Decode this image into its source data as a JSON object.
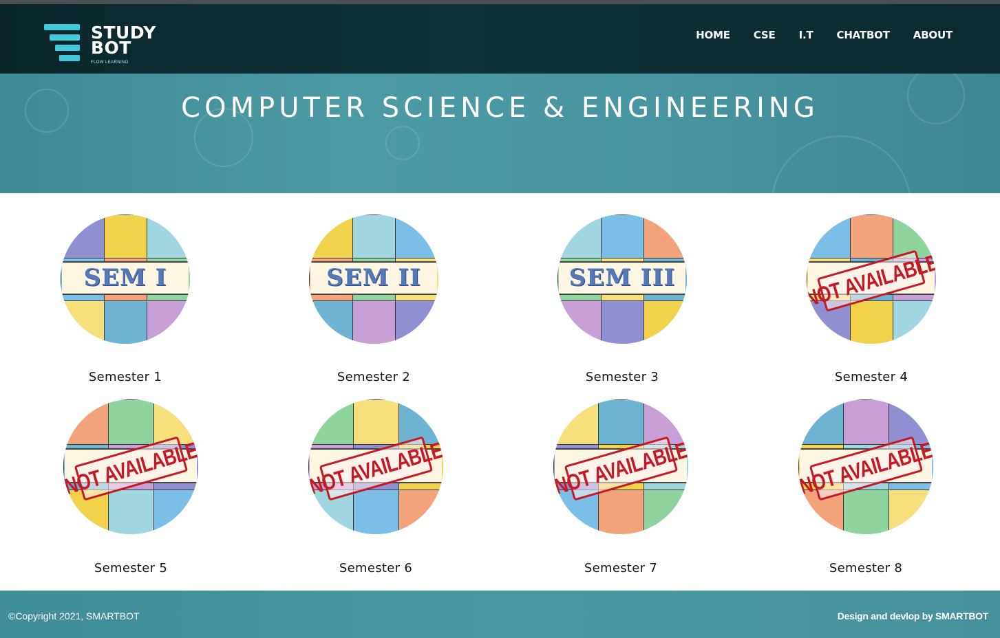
{
  "brand": {
    "line1": "STUDY",
    "line2": "BOT",
    "tagline": "FLOW LEARNING",
    "accent_color": "#44c8dc"
  },
  "nav": {
    "items": [
      {
        "label": "HOME"
      },
      {
        "label": "CSE"
      },
      {
        "label": "I.T"
      },
      {
        "label": "CHATBOT"
      },
      {
        "label": "ABOUT"
      }
    ]
  },
  "hero": {
    "title": "COMPUTER SCIENCE & ENGINEERING"
  },
  "semesters": [
    {
      "label": "Semester 1",
      "badge": "SEM I",
      "available": true
    },
    {
      "label": "Semester 2",
      "badge": "SEM II",
      "available": true
    },
    {
      "label": "Semester 3",
      "badge": "SEM III",
      "available": true
    },
    {
      "label": "Semester 4",
      "badge": "NOT AVAILABLE",
      "available": false
    },
    {
      "label": "Semester 5",
      "badge": "NOT AVAILABLE",
      "available": false
    },
    {
      "label": "Semester 6",
      "badge": "NOT AVAILABLE",
      "available": false
    },
    {
      "label": "Semester 7",
      "badge": "NOT AVAILABLE",
      "available": false
    },
    {
      "label": "Semester 8",
      "badge": "NOT AVAILABLE",
      "available": false
    }
  ],
  "footer": {
    "copyright": "©Copyright 2021, SMARTBOT",
    "credit": "Design and devlop by SMARTBOT"
  },
  "colors": {
    "navbar": "#0f3137",
    "hero": "#4c9aa3",
    "footer": "#4a99a1",
    "stamp": "#c41a25"
  }
}
